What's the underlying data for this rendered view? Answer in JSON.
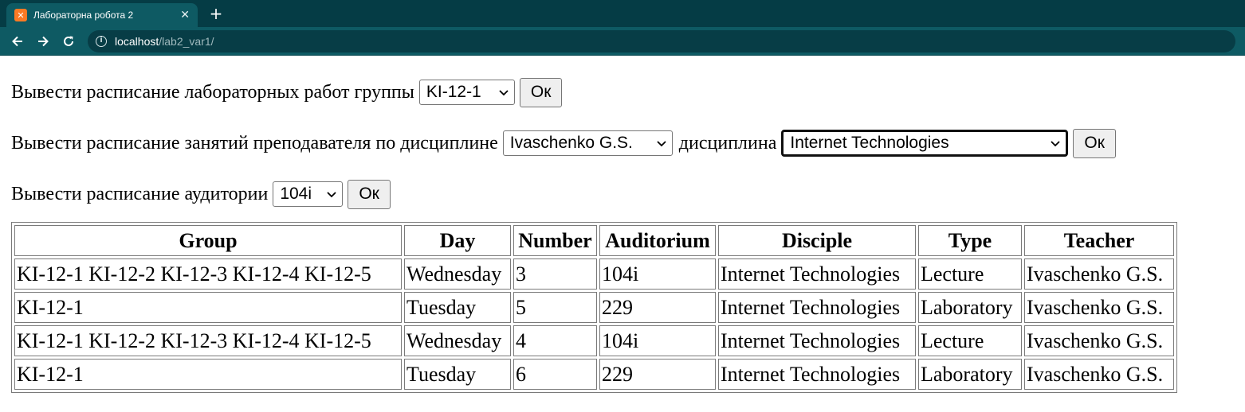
{
  "browser": {
    "tab_title": "Лабораторна робота 2",
    "tab_close_icon": "close-icon",
    "new_tab_icon": "plus-icon",
    "url_host": "localhost",
    "url_path": "/lab2_var1/",
    "accent_color": "#053c45",
    "toolbar_color": "#0e5a63",
    "favicon_color": "#fb7a24"
  },
  "form_group": {
    "label": "Вывести расписание лабораторных работ группы",
    "selected": "KI-12-1",
    "button": "Ок"
  },
  "form_teacher": {
    "label": "Вывести расписание занятий преподавателя по дисциплине",
    "teacher_selected": "Ivaschenko G.S.",
    "label2": "дисциплина",
    "discipline_selected": "Internet Technologies",
    "button": "Ок"
  },
  "form_auditorium": {
    "label": "Вывести расписание аудитории",
    "selected": "104i",
    "button": "Ок"
  },
  "table": {
    "headers": [
      "Group",
      "Day",
      "Number",
      "Auditorium",
      "Disciple",
      "Type",
      "Teacher"
    ],
    "rows": [
      [
        "KI-12-1 KI-12-2 KI-12-3 KI-12-4 KI-12-5",
        "Wednesday",
        "3",
        "104i",
        "Internet Technologies",
        "Lecture",
        "Ivaschenko G.S."
      ],
      [
        "KI-12-1",
        "Tuesday",
        "5",
        "229",
        "Internet Technologies",
        "Laboratory",
        "Ivaschenko G.S."
      ],
      [
        "KI-12-1 KI-12-2 KI-12-3 KI-12-4 KI-12-5",
        "Wednesday",
        "4",
        "104i",
        "Internet Technologies",
        "Lecture",
        "Ivaschenko G.S."
      ],
      [
        "KI-12-1",
        "Tuesday",
        "6",
        "229",
        "Internet Technologies",
        "Laboratory",
        "Ivaschenko G.S."
      ]
    ]
  }
}
